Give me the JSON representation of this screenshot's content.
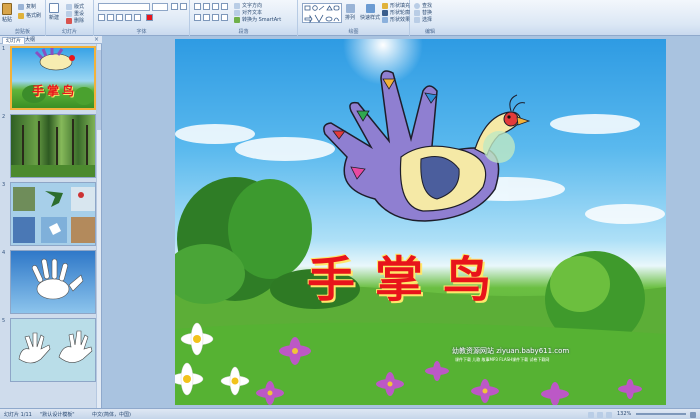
{
  "ribbon": {
    "clipboard": {
      "paste": "粘贴",
      "copy": "复制",
      "format": "格式刷",
      "label": "剪贴板"
    },
    "slides": {
      "new": "新建",
      "layout": "版式",
      "reset": "重设",
      "delete": "删除",
      "label": "幻灯片"
    },
    "font": {
      "label": "字体"
    },
    "paragraph": {
      "text_direction": "文字方向",
      "align_text": "对齐文本",
      "smartart": "转换为 SmartArt",
      "label": "段落"
    },
    "drawing": {
      "arrange": "排列",
      "quick_styles": "快速样式",
      "shape_fill": "形状填充",
      "shape_outline": "形状轮廓",
      "shape_effects": "形状效果",
      "label": "绘图"
    },
    "editing": {
      "find": "查找",
      "replace": "替换",
      "select": "选择",
      "label": "编辑"
    }
  },
  "left_panel": {
    "tabs": [
      "幻灯片",
      "大纲"
    ],
    "close": "×",
    "thumbnails": [
      {
        "num": "1",
        "title": "手掌鸟"
      },
      {
        "num": "2"
      },
      {
        "num": "3"
      },
      {
        "num": "4"
      },
      {
        "num": "5"
      }
    ]
  },
  "slide": {
    "title": "手掌鸟",
    "watermark": "幼教资源网站 ziyuan.baby611.com",
    "subline": "课件下载 儿歌 故事MP3 FLASH课件下载 试卷下载网"
  },
  "status": {
    "slide_info": "幻灯片 1/11",
    "theme": "\"默认设计模板\"",
    "language": "中文(简体，中国)",
    "zoom": "132%"
  },
  "colors": {
    "title_red": "#e8141b",
    "ribbon_bg": "#dbe7f5",
    "selection": "#f2b23a"
  }
}
